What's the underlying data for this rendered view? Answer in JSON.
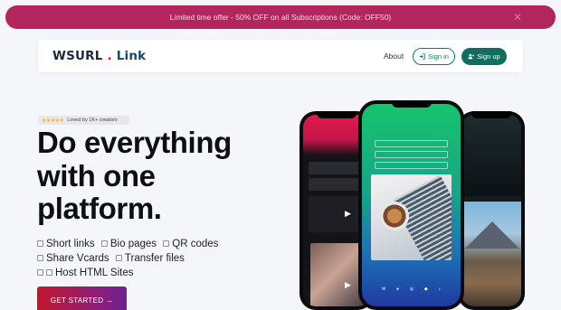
{
  "promo": {
    "text": "Limited time offer - 50% OFF on all Subscriptions (Code: OFF50)",
    "close_glyph": "✕"
  },
  "nav": {
    "logo_main": "WSURL",
    "logo_dot": ".",
    "logo_sub": "Link",
    "about": "About",
    "signin": "Sign in",
    "signup": "Sign up",
    "signin_icon": "login-icon",
    "signup_icon": "user-plus-icon"
  },
  "hero": {
    "badge_stars": "★★★★★",
    "badge_text": "Loved by 1K+ creators",
    "title_line1": "Do everything",
    "title_line2": "with one",
    "title_line3": "platform.",
    "features": [
      "Short links",
      "Bio pages",
      "QR codes",
      "Share Vcards",
      "Transfer files",
      "Host HTML Sites"
    ],
    "cta": "GET STARTED →"
  },
  "colors": {
    "promo_bg": "#b3265d",
    "accent": "#0f6e60",
    "logo_dot": "#e4002b",
    "cta_start": "#c0182d",
    "cta_end": "#6b2190"
  }
}
